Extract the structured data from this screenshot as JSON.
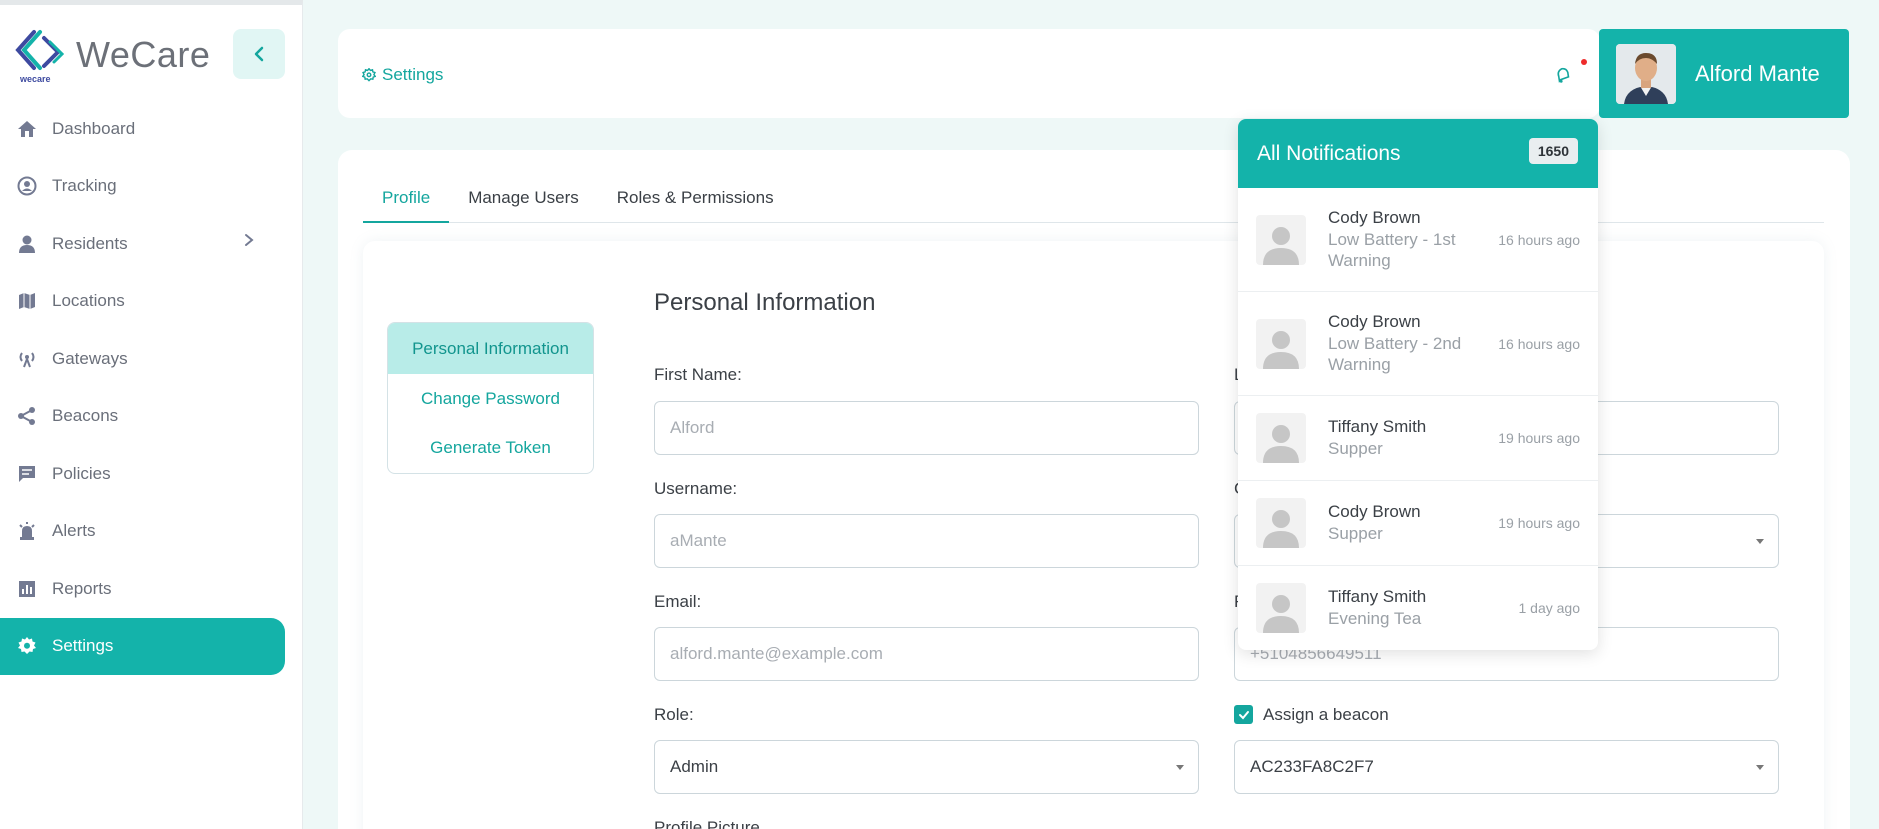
{
  "brand": {
    "name": "WeCare",
    "sub": "wecare"
  },
  "sidebar": {
    "items": [
      {
        "label": "Dashboard",
        "icon": "home-icon"
      },
      {
        "label": "Tracking",
        "icon": "location-pin-icon"
      },
      {
        "label": "Residents",
        "icon": "person-icon"
      },
      {
        "label": "Locations",
        "icon": "map-icon"
      },
      {
        "label": "Gateways",
        "icon": "antenna-icon"
      },
      {
        "label": "Beacons",
        "icon": "share-icon"
      },
      {
        "label": "Policies",
        "icon": "comment-icon"
      },
      {
        "label": "Alerts",
        "icon": "alarm-icon"
      },
      {
        "label": "Reports",
        "icon": "bar-chart-icon"
      },
      {
        "label": "Settings",
        "icon": "gear-icon",
        "active": true
      }
    ]
  },
  "header": {
    "breadcrumb": "Settings",
    "user_name": "Alford Mante"
  },
  "tabs": [
    {
      "label": "Profile",
      "active": true
    },
    {
      "label": "Manage Users"
    },
    {
      "label": "Roles & Permissions"
    }
  ],
  "side_menu": [
    "Personal Information",
    "Change Password",
    "Generate Token"
  ],
  "form": {
    "title": "Personal Information",
    "first_name_label": "First Name:",
    "first_name_value": "Alford",
    "last_name_label": "L",
    "username_label": "Username:",
    "username_value": "aMante",
    "col2_label_2": "C",
    "email_label": "Email:",
    "email_value": "alford.mante@example.com",
    "col2_label_3": "F",
    "phone_value": "+5104856649511",
    "role_label": "Role:",
    "role_value": "Admin",
    "assign_beacon_label": "Assign a beacon",
    "beacon_value": "AC233FA8C2F7",
    "profile_picture_label": "Profile Picture"
  },
  "notifications": {
    "title": "All Notifications",
    "count": "1650",
    "items": [
      {
        "name": "Cody Brown",
        "message": "Low Battery - 1st Warning",
        "time": "16 hours ago"
      },
      {
        "name": "Cody Brown",
        "message": "Low Battery - 2nd Warning",
        "time": "16 hours ago"
      },
      {
        "name": "Tiffany Smith",
        "message": "Supper",
        "time": "19 hours ago"
      },
      {
        "name": "Cody Brown",
        "message": "Supper",
        "time": "19 hours ago"
      },
      {
        "name": "Tiffany Smith",
        "message": "Evening Tea",
        "time": "1 day ago"
      }
    ]
  },
  "colors": {
    "accent": "#14b3aa",
    "accent_dark": "#14a69e",
    "alert_dot": "#ee2b2b"
  }
}
